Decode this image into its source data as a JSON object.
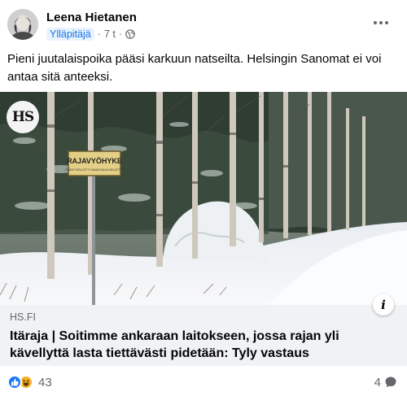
{
  "post": {
    "author": "Leena Hietanen",
    "role": "Ylläpitäjä",
    "time": "7 t",
    "separator": "·",
    "privacy_icon": "globe-icon",
    "more_icon": "more-options-icon",
    "text": "Pieni juutalaispoika pääsi karkuun natseilta. Helsingin Sanomat ei voi antaa sitä anteeksi."
  },
  "link": {
    "source_logo": "HS",
    "sign_text": "RAJAVYÖHYKE",
    "sign_subtext": "PÄÄSY KIELLETTY MAAN RAJA KIELLETTY",
    "domain": "HS.FI",
    "title": "Itäraja | Soitimme ankaraan laitokseen, jossa rajan yli kävellyttä lasta tiettävästi pidetään: Tyly vastaus",
    "info_icon": "i"
  },
  "footer": {
    "reaction_icons": [
      "like-icon",
      "haha-icon"
    ],
    "reaction_count": "43",
    "comment_count": "4",
    "comment_icon": "comment-bubble-icon"
  },
  "colors": {
    "accent": "#1877f2",
    "badge_bg": "#e7f3ff",
    "badge_text": "#1b74e4",
    "muted_text": "#65676b",
    "link_bg": "#f0f2f5"
  }
}
